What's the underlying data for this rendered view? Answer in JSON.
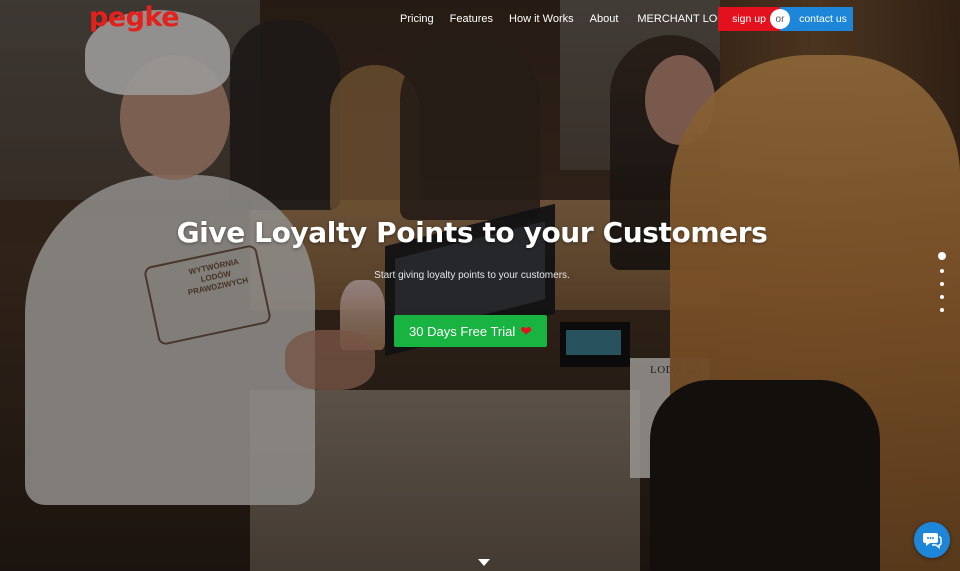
{
  "header": {
    "logo_text": "pegke",
    "nav": [
      {
        "label": "Pricing"
      },
      {
        "label": "Features"
      },
      {
        "label": "How it Works"
      },
      {
        "label": "About"
      },
      {
        "label": "MERCHANT LOG IN"
      }
    ],
    "signup_label": "sign up",
    "or_label": "or",
    "contact_label": "contact us"
  },
  "hero": {
    "title": "Give Loyalty Points to your Customers",
    "subtitle": "Start giving loyalty points to your customers.",
    "cta_label": "30 Days Free Trial",
    "cta_icon": "heart-icon"
  },
  "background": {
    "sign_text": "LODY NA",
    "shirt_logo_text": "WYTWÓRNIA LODÓW PRAWDZIWYCH"
  },
  "slider": {
    "total_slides": 5,
    "active_slide": 1
  },
  "colors": {
    "brand_red": "#e3201b",
    "signup_red": "#e3111d",
    "contact_blue": "#1e86d9",
    "cta_green": "#19b341"
  },
  "icons": {
    "chat": "chat-bubble-icon",
    "scroll_down": "chevron-down-icon"
  }
}
